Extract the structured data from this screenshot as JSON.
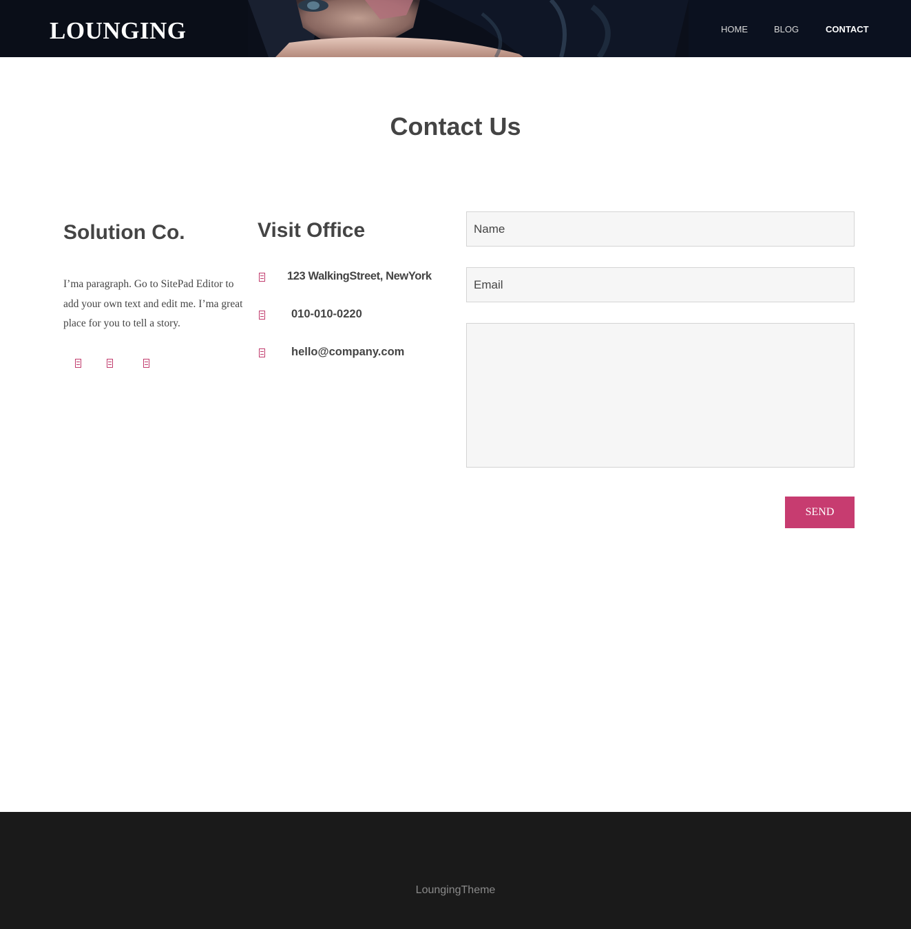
{
  "header": {
    "logo": "LOUNGING",
    "nav": [
      {
        "label": "HOME",
        "active": false
      },
      {
        "label": "BLOG",
        "active": false
      },
      {
        "label": "CONTACT",
        "active": true
      }
    ]
  },
  "page": {
    "title": "Contact Us"
  },
  "company": {
    "title": "Solution Co.",
    "paragraph": "I’ma paragraph.  Go to SitePad Editor to add your own text and edit me. I’ma great place for you to tell a story.",
    "social_icons": [
      "facebook-icon",
      "twitter-icon",
      "linkedin-icon"
    ]
  },
  "office": {
    "title": "Visit Office",
    "items": [
      {
        "icon": "map-marker-icon",
        "text": "123 WalkingStreet, NewYork"
      },
      {
        "icon": "phone-icon",
        "text": "010-010-0220"
      },
      {
        "icon": "envelope-icon",
        "text": "hello@company.com"
      }
    ]
  },
  "form": {
    "name_placeholder": "Name",
    "email_placeholder": "Email",
    "message_placeholder": "",
    "send_label": "SEND"
  },
  "footer": {
    "text": "LoungingTheme"
  },
  "colors": {
    "accent": "#c73c70",
    "text": "#444444",
    "footer_bg": "#1a1a1a",
    "field_bg": "#f6f6f6"
  }
}
